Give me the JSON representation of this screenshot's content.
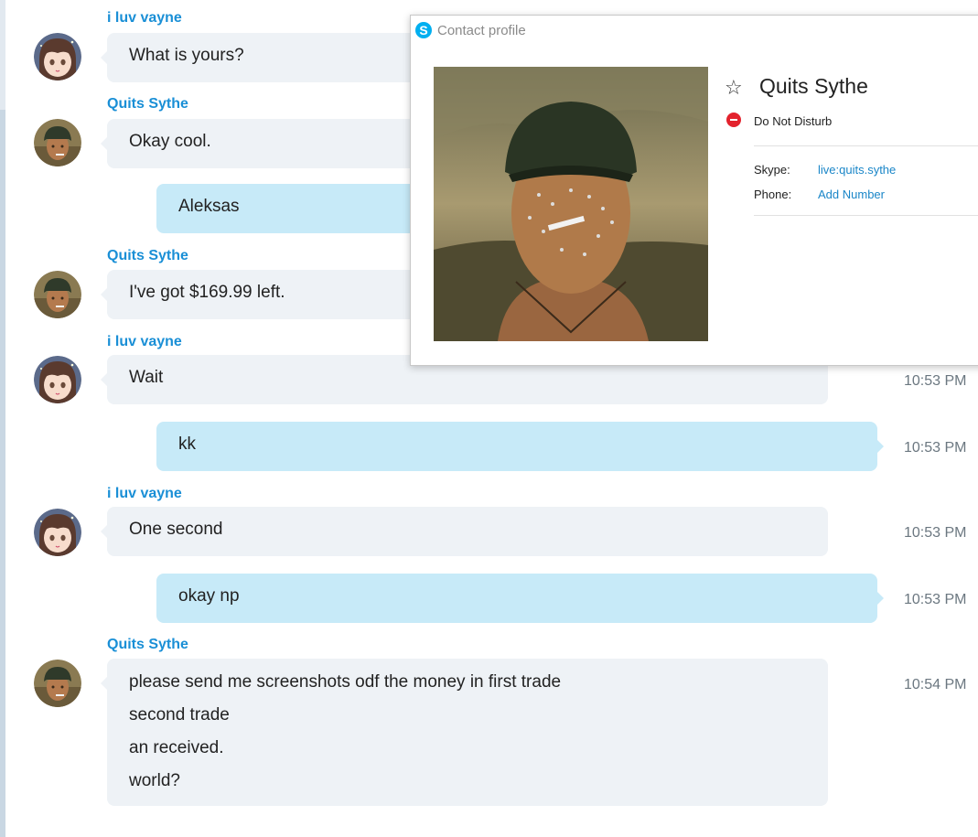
{
  "messages": [
    {
      "sender": "i luv vayne",
      "text": "What is yours?",
      "direction": "in"
    },
    {
      "sender": "Quits Sythe",
      "text": "Okay cool.",
      "direction": "in"
    },
    {
      "text": "Aleksas",
      "direction": "out"
    },
    {
      "sender": "Quits Sythe",
      "text": "I've got $169.99 left.",
      "direction": "in"
    },
    {
      "sender": "i luv vayne",
      "text": "Wait",
      "direction": "in",
      "time": "10:53 PM"
    },
    {
      "text": "kk",
      "direction": "out",
      "time": "10:53 PM"
    },
    {
      "sender": "i luv vayne",
      "text": "One second",
      "direction": "in",
      "time": "10:53 PM"
    },
    {
      "text": "okay np",
      "direction": "out",
      "time": "10:53 PM"
    },
    {
      "sender": "Quits Sythe",
      "lines": [
        "please send me screenshots odf the money in first trade",
        "second trade",
        "an received.",
        "world?"
      ],
      "direction": "in",
      "time": "10:54 PM"
    }
  ],
  "popup": {
    "title": "Contact profile",
    "name": "Quits Sythe",
    "status": "Do Not Disturb",
    "skype_label": "Skype:",
    "skype_value": "live:quits.sythe",
    "phone_label": "Phone:",
    "phone_value": "Add Number"
  },
  "colors": {
    "accent": "#1a8fd6",
    "incoming_bubble": "#eef2f6",
    "outgoing_bubble": "#c7eaf8",
    "dnd": "#e3222d"
  },
  "icons": {
    "favorite": "star-outline-icon",
    "status": "do-not-disturb-icon",
    "app": "skype-logo-icon"
  }
}
